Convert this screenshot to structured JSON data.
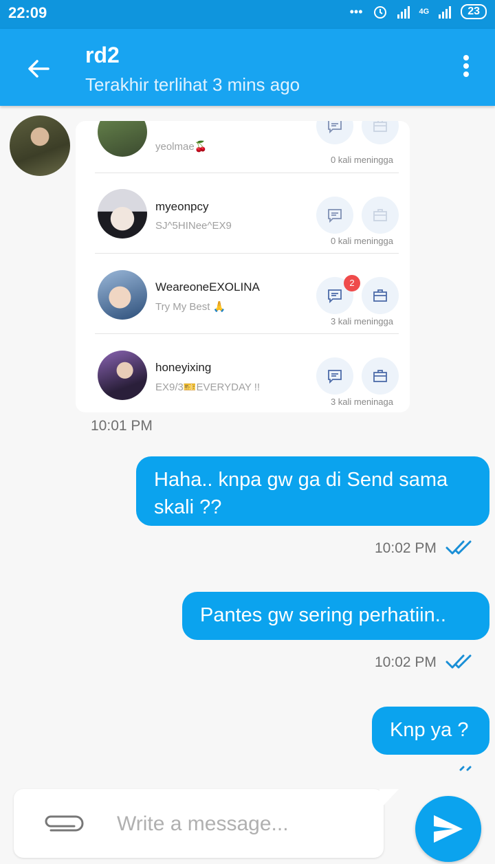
{
  "status_bar": {
    "time": "22:09",
    "dots": "•••",
    "network": "4G",
    "battery": "23"
  },
  "header": {
    "title": "rd2",
    "subtitle": "Terakhir terlihat 3 mins ago"
  },
  "card": {
    "rows": [
      {
        "name": "",
        "bio": "yeolmae🍒",
        "meta": "0 kali meningga",
        "badge": ""
      },
      {
        "name": "myeonpcy",
        "bio": "SJ^5HINee^EX9",
        "meta": "0 kali meningga",
        "badge": ""
      },
      {
        "name": "WeareoneEXOLINA",
        "bio": "Try My Best 🙏",
        "meta": "3 kali meningga",
        "badge": "2"
      },
      {
        "name": "honeyixing",
        "bio": "EX9/3🎫EVERYDAY !!",
        "meta": "3 kali meninaga",
        "badge": ""
      }
    ]
  },
  "messages": {
    "card_time": "10:01 PM",
    "m1": {
      "text": "Haha.. knpa gw ga di Send sama skali ??",
      "time": "10:02 PM"
    },
    "m2": {
      "text": "Pantes gw sering perhatiin..",
      "time": "10:02 PM"
    },
    "m3": {
      "text": "Knp ya ?"
    }
  },
  "composer": {
    "placeholder": "Write a message..."
  },
  "colors": {
    "header": "#18a4f1",
    "status_bar": "#0f95dd",
    "bubble": "#0ba3ee",
    "badge": "#ef4b4b"
  }
}
